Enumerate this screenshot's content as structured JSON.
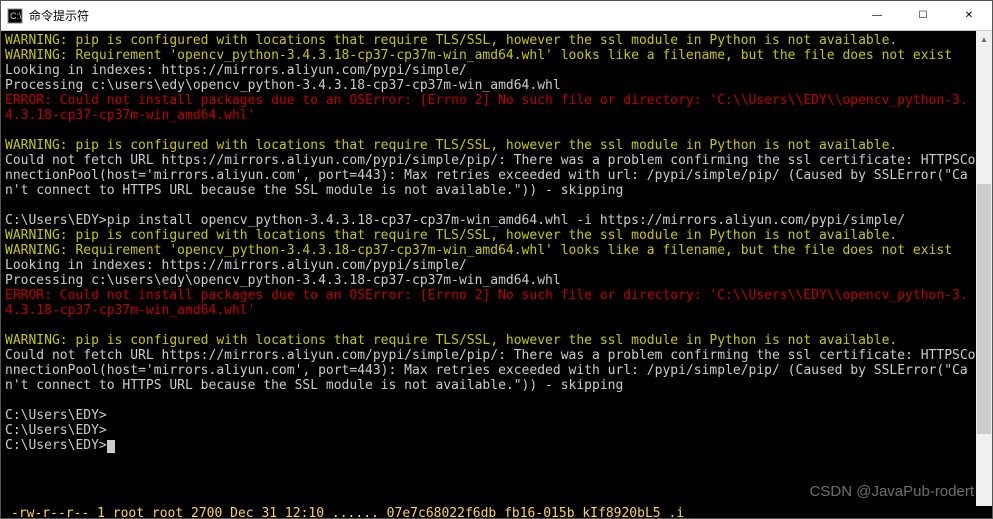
{
  "window": {
    "title": "命令提示符",
    "icon_label": "cmd-icon",
    "controls": {
      "min": "—",
      "max": "☐",
      "close": "✕"
    }
  },
  "terminal": {
    "lines": [
      {
        "cls": "yellow",
        "text": "WARNING: pip is configured with locations that require TLS/SSL, however the ssl module in Python is not available."
      },
      {
        "cls": "yellow",
        "text": "WARNING: Requirement 'opencv_python-3.4.3.18-cp37-cp37m-win_amd64.whl' looks like a filename, but the file does not exist"
      },
      {
        "cls": "white",
        "text": "Looking in indexes: https://mirrors.aliyun.com/pypi/simple/"
      },
      {
        "cls": "white",
        "text": "Processing c:\\users\\edy\\opencv_python-3.4.3.18-cp37-cp37m-win_amd64.whl"
      },
      {
        "cls": "red",
        "text": "ERROR: Could not install packages due to an OSError: [Errno 2] No such file or directory: 'C:\\\\Users\\\\EDY\\\\opencv_python-3.4.3.18-cp37-cp37m-win_amd64.whl'"
      },
      {
        "cls": "white",
        "text": ""
      },
      {
        "cls": "yellow",
        "text": "WARNING: pip is configured with locations that require TLS/SSL, however the ssl module in Python is not available."
      },
      {
        "cls": "white",
        "text": "Could not fetch URL https://mirrors.aliyun.com/pypi/simple/pip/: There was a problem confirming the ssl certificate: HTTPSConnectionPool(host='mirrors.aliyun.com', port=443): Max retries exceeded with url: /pypi/simple/pip/ (Caused by SSLError(\"Can't connect to HTTPS URL because the SSL module is not available.\")) - skipping"
      },
      {
        "cls": "white",
        "text": ""
      },
      {
        "cls": "white",
        "text": "C:\\Users\\EDY>pip install opencv_python-3.4.3.18-cp37-cp37m-win_amd64.whl -i https://mirrors.aliyun.com/pypi/simple/"
      },
      {
        "cls": "yellow",
        "text": "WARNING: pip is configured with locations that require TLS/SSL, however the ssl module in Python is not available."
      },
      {
        "cls": "yellow",
        "text": "WARNING: Requirement 'opencv_python-3.4.3.18-cp37-cp37m-win_amd64.whl' looks like a filename, but the file does not exist"
      },
      {
        "cls": "white",
        "text": "Looking in indexes: https://mirrors.aliyun.com/pypi/simple/"
      },
      {
        "cls": "white",
        "text": "Processing c:\\users\\edy\\opencv_python-3.4.3.18-cp37-cp37m-win_amd64.whl"
      },
      {
        "cls": "red",
        "text": "ERROR: Could not install packages due to an OSError: [Errno 2] No such file or directory: 'C:\\\\Users\\\\EDY\\\\opencv_python-3.4.3.18-cp37-cp37m-win_amd64.whl'"
      },
      {
        "cls": "white",
        "text": ""
      },
      {
        "cls": "yellow",
        "text": "WARNING: pip is configured with locations that require TLS/SSL, however the ssl module in Python is not available."
      },
      {
        "cls": "white",
        "text": "Could not fetch URL https://mirrors.aliyun.com/pypi/simple/pip/: There was a problem confirming the ssl certificate: HTTPSConnectionPool(host='mirrors.aliyun.com', port=443): Max retries exceeded with url: /pypi/simple/pip/ (Caused by SSLError(\"Can't connect to HTTPS URL because the SSL module is not available.\")) - skipping"
      },
      {
        "cls": "white",
        "text": ""
      },
      {
        "cls": "white",
        "text": "C:\\Users\\EDY>"
      },
      {
        "cls": "white",
        "text": "C:\\Users\\EDY>"
      }
    ],
    "prompt_line": "C:\\Users\\EDY>",
    "cursor_line": true
  },
  "scrollbar": {
    "up": "▲",
    "down": "▼"
  },
  "watermark": "CSDN @JavaPub-rodert",
  "bottom_crop": "-rw-r--r--   1  root  root  2700 Dec 31 12:10  ......  07e7c68022f6db fb16-015b kIf8920bL5 .i"
}
